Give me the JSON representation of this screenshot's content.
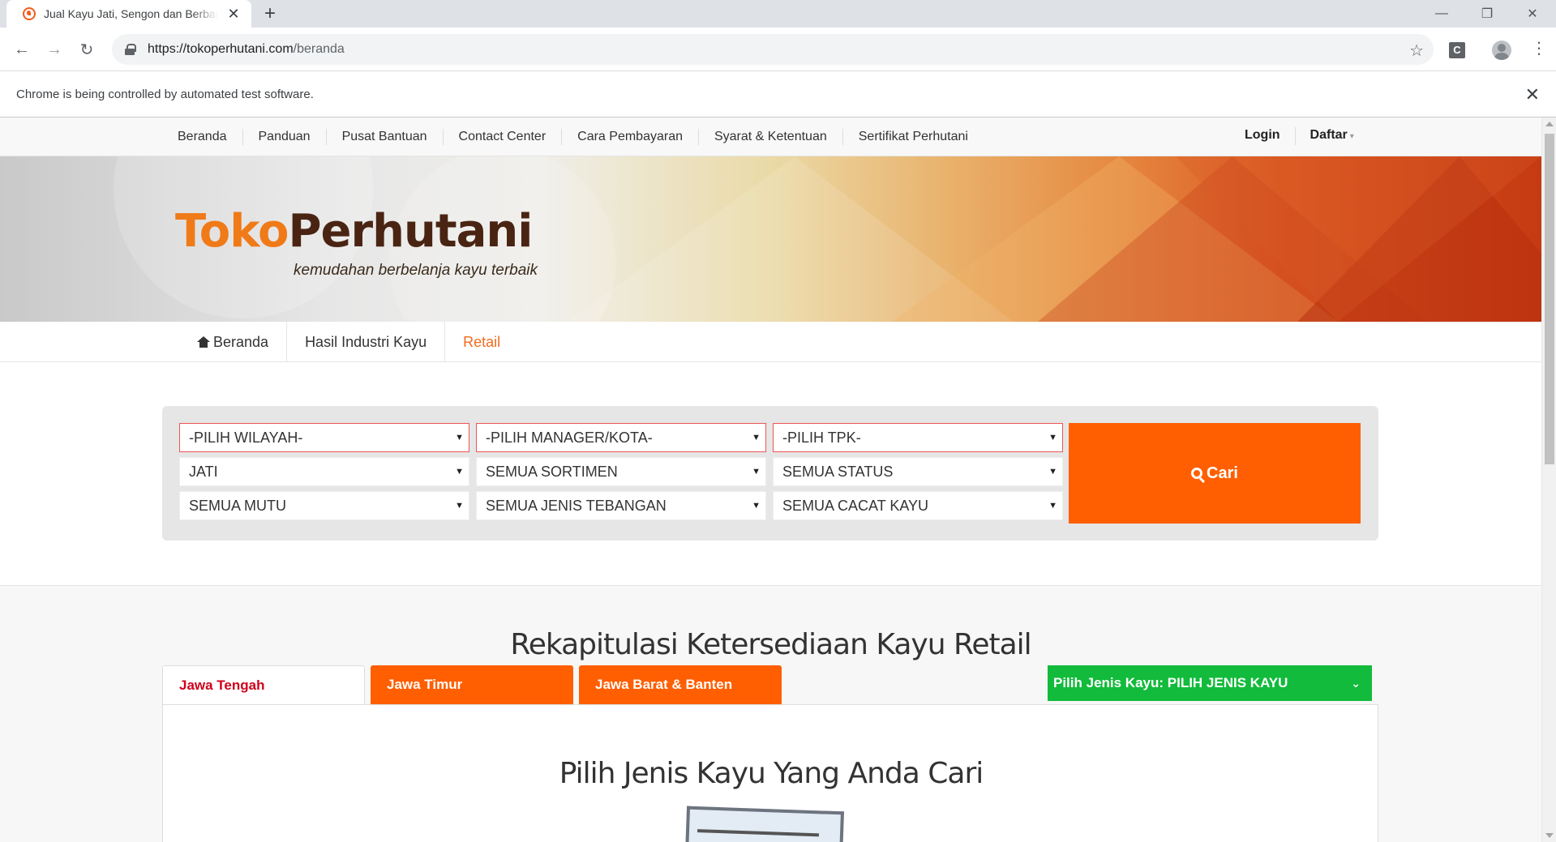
{
  "browser": {
    "tab_title": "Jual Kayu Jati, Sengon dan Berbagai Kayu",
    "url_host": "https://tokoperhutani.com",
    "url_path": "/beranda",
    "extension_label": "C",
    "infobar_message": "Chrome is being controlled by automated test software."
  },
  "topnav": {
    "links": [
      "Beranda",
      "Panduan",
      "Pusat Bantuan",
      "Contact Center",
      "Cara Pembayaran",
      "Syarat & Ketentuan",
      "Sertifikat Perhutani"
    ],
    "login": "Login",
    "daftar": "Daftar"
  },
  "banner": {
    "logo_part1": "Toko",
    "logo_part2": "Perhutani",
    "tagline": "kemudahan berbelanja kayu terbaik"
  },
  "secnav": {
    "items": [
      "Beranda",
      "Hasil Industri Kayu",
      "Retail"
    ],
    "active": "Retail"
  },
  "search": {
    "wilayah": "-PILIH WILAYAH-",
    "manager": "-PILIH MANAGER/KOTA-",
    "tpk": "-PILIH TPK-",
    "jenis": "JATI",
    "sortimen": "SEMUA SORTIMEN",
    "status": "SEMUA STATUS",
    "mutu": "SEMUA MUTU",
    "tebangan": "SEMUA JENIS TEBANGAN",
    "cacat": "SEMUA CACAT KAYU",
    "button": "Cari"
  },
  "recap": {
    "title": "Rekapitulasi Ketersediaan Kayu Retail",
    "tabs": [
      "Jawa Tengah",
      "Jawa Timur",
      "Jawa Barat & Banten"
    ],
    "active_tab": "Jawa Tengah",
    "jenis_dropdown": "Pilih Jenis Kayu: PILIH JENIS KAYU",
    "content_title": "Pilih Jenis Kayu Yang Anda Cari"
  },
  "colors": {
    "brand_orange": "#ff5f00",
    "green": "#12bb3b",
    "active_tab_red": "#d0001c"
  }
}
